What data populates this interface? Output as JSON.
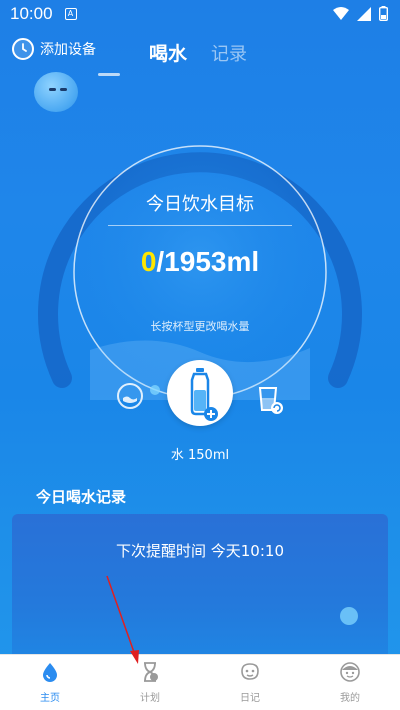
{
  "status_bar": {
    "time": "10:00",
    "notification_icon": "A"
  },
  "header": {
    "add_device": "添加设备",
    "tabs": [
      {
        "label": "喝水",
        "active": true
      },
      {
        "label": "记录",
        "active": false
      }
    ]
  },
  "goal": {
    "title": "今日饮水目标",
    "current": "0",
    "target": "/1953ml",
    "hint": "长按杯型更改喝水量"
  },
  "cup": {
    "label": "水 150ml"
  },
  "records": {
    "title": "今日喝水记录",
    "reminder": "下次提醒时间 今天10:10"
  },
  "tabbar": [
    {
      "label": "主页",
      "icon": "water-drop-icon",
      "active": true
    },
    {
      "label": "计划",
      "icon": "hourglass-icon",
      "active": false
    },
    {
      "label": "日记",
      "icon": "diary-icon",
      "active": false
    },
    {
      "label": "我的",
      "icon": "profile-icon",
      "active": false
    }
  ],
  "colors": {
    "accent": "#2b8cf0",
    "highlight": "#ffe600",
    "background": "#1f86ea"
  }
}
